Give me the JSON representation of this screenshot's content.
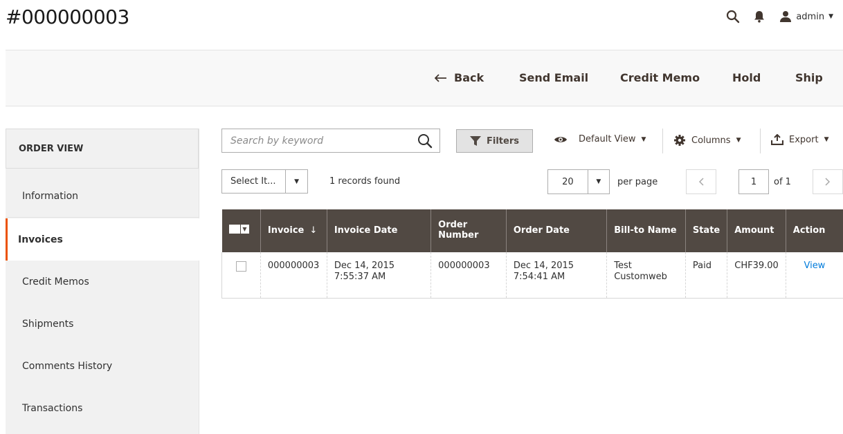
{
  "page": {
    "title": "#000000003"
  },
  "header": {
    "user_label": "admin"
  },
  "actions": {
    "back": "Back",
    "send_email": "Send Email",
    "credit_memo": "Credit Memo",
    "hold": "Hold",
    "ship": "Ship"
  },
  "sidebar": {
    "title": "ORDER VIEW",
    "items": [
      {
        "label": "Information"
      },
      {
        "label": "Invoices"
      },
      {
        "label": "Credit Memos"
      },
      {
        "label": "Shipments"
      },
      {
        "label": "Comments History"
      },
      {
        "label": "Transactions"
      }
    ],
    "active": "Invoices"
  },
  "toolbar": {
    "search_placeholder": "Search by keyword",
    "filters": "Filters",
    "default_view": "Default View",
    "columns": "Columns",
    "export": "Export",
    "mass_select": "Select It...",
    "records": "1 records found",
    "per_page_value": "20",
    "per_page_label": "per page",
    "page_current": "1",
    "page_total": "of 1"
  },
  "table": {
    "headers": [
      "Invoice",
      "Invoice Date",
      "Order Number",
      "Order Date",
      "Bill-to Name",
      "State",
      "Amount",
      "Action"
    ],
    "rows": [
      {
        "invoice": "000000003",
        "invoice_date_1": "Dec 14, 2015",
        "invoice_date_2": "7:55:37 AM",
        "order_number": "000000003",
        "order_date_1": "Dec 14, 2015",
        "order_date_2": "7:54:41 AM",
        "bill_to_1": "Test",
        "bill_to_2": "Customweb",
        "state": "Paid",
        "amount": "CHF39.00",
        "action": "View"
      }
    ]
  },
  "colors": {
    "accent": "#eb5202",
    "header_bg": "#514943",
    "link": "#007bdb"
  }
}
